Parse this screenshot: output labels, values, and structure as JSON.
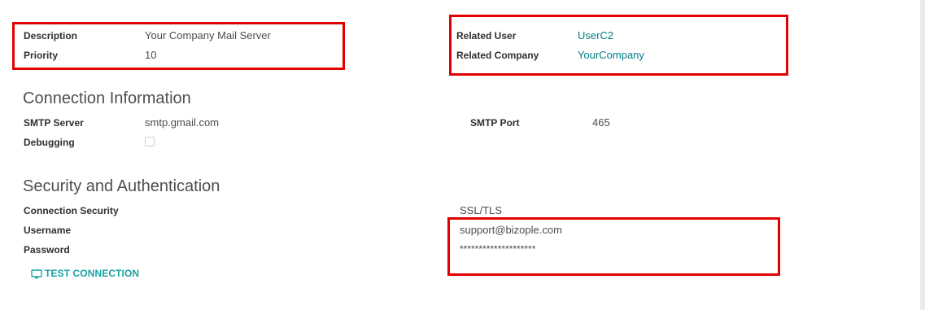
{
  "general": {
    "description_label": "Description",
    "description_value": "Your Company Mail Server",
    "priority_label": "Priority",
    "priority_value": "10",
    "related_user_label": "Related User",
    "related_user_value": "UserC2",
    "related_company_label": "Related Company",
    "related_company_value": "YourCompany"
  },
  "connection": {
    "heading": "Connection Information",
    "smtp_server_label": "SMTP Server",
    "smtp_server_value": "smtp.gmail.com",
    "smtp_port_label": "SMTP Port",
    "smtp_port_value": "465",
    "debugging_label": "Debugging",
    "debugging_checked": false
  },
  "security": {
    "heading": "Security and Authentication",
    "connection_security_label": "Connection Security",
    "connection_security_value": "SSL/TLS",
    "username_label": "Username",
    "username_value": "support@bizople.com",
    "password_label": "Password",
    "password_value": "********************"
  },
  "actions": {
    "test_connection_label": "TEST CONNECTION",
    "test_connection_icon": "monitor-icon"
  },
  "colors": {
    "highlight_border": "#e30000",
    "link": "#017e84",
    "button": "#17a2a2"
  }
}
